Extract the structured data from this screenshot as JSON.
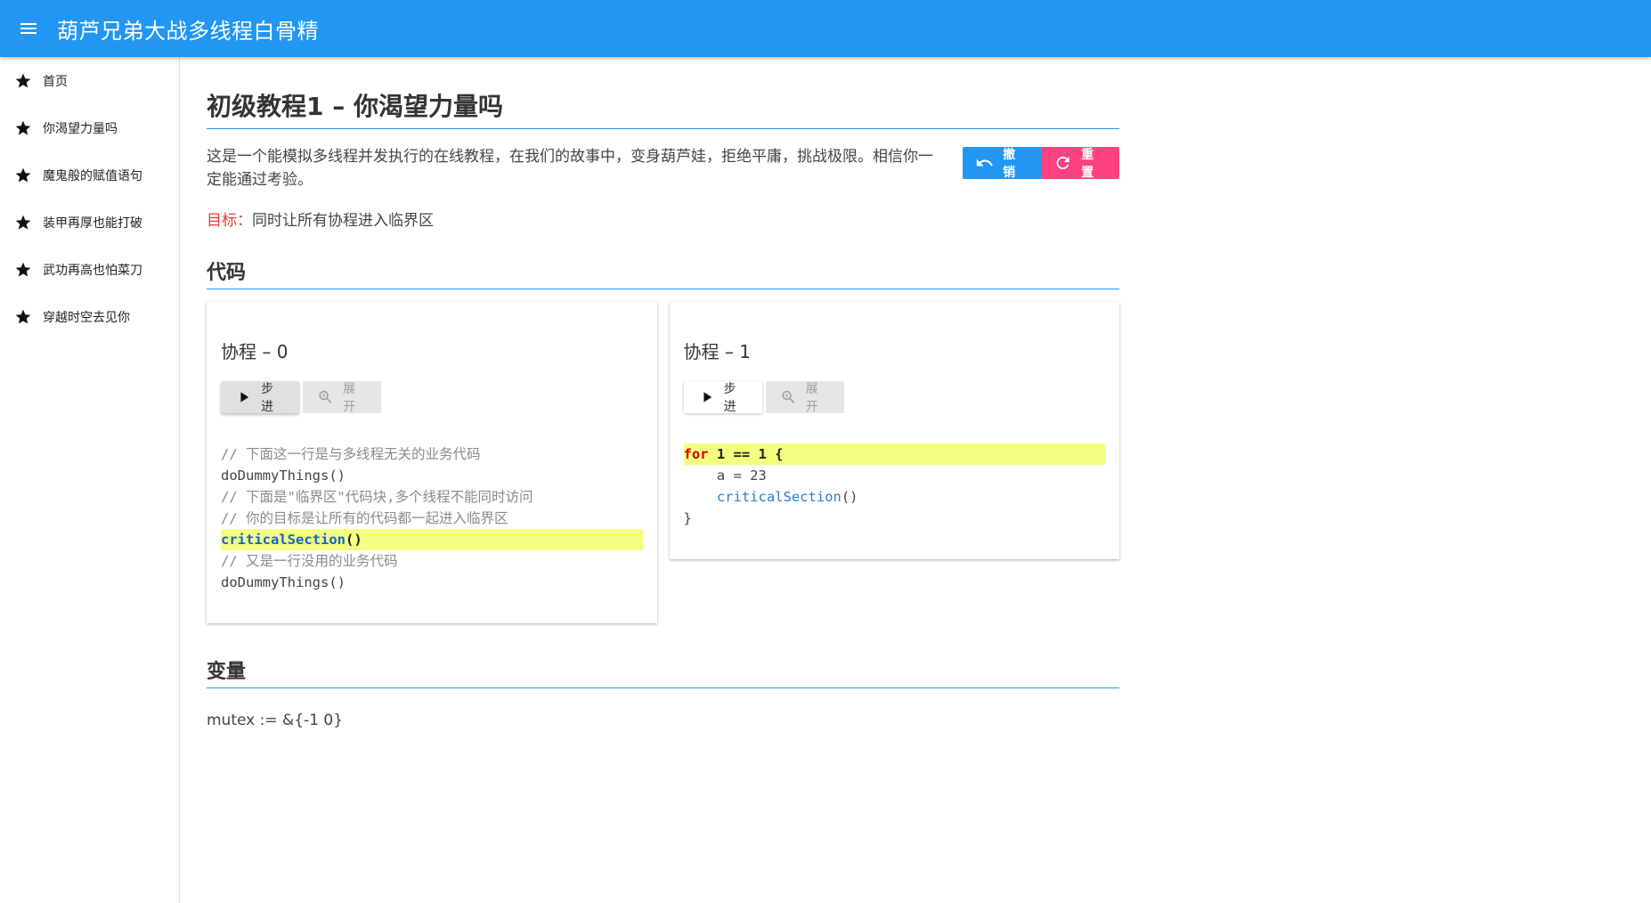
{
  "app": {
    "title": "葫芦兄弟大战多线程白骨精"
  },
  "sidebar": {
    "items": [
      {
        "label": "首页"
      },
      {
        "label": "你渴望力量吗"
      },
      {
        "label": "魔鬼般的赋值语句"
      },
      {
        "label": "装甲再厚也能打破"
      },
      {
        "label": "武功再高也怕菜刀"
      },
      {
        "label": "穿越时空去见你"
      }
    ]
  },
  "main": {
    "title": "初级教程1 – 你渴望力量吗",
    "intro": "这是一个能模拟多线程并发执行的在线教程，在我们的故事中，变身葫芦娃，拒绝平庸，挑战极限。相信你一定能通过考验。",
    "undo_label": "撤销",
    "reset_label": "重置",
    "goal_label": "目标：",
    "goal_text": "同时让所有协程进入临界区",
    "code_section": "代码",
    "vars_section": "变量",
    "step_label": "步进",
    "expand_label": "展开",
    "coroutines": [
      {
        "title": "协程 – 0",
        "lines": [
          "// 下面这一行是与多线程无关的业务代码",
          "doDummyThings",
          "()",
          "// 下面是\"临界区\"代码块,多个线程不能同时访问",
          "// 你的目标是让所有的代码都一起进入临界区",
          "criticalSection",
          "()",
          "// 又是一行没用的业务代码",
          "doDummyThings",
          "()"
        ]
      },
      {
        "title": "协程 – 1",
        "lines": [
          "for",
          " 1 == 1 {",
          "    a = 23",
          "    ",
          "criticalSection",
          "()",
          "}"
        ]
      }
    ],
    "variables": "mutex := &{-1 0}"
  },
  "colors": {
    "primary": "#2196f3",
    "accent": "#ff4081",
    "highlight": "#f4ff81"
  },
  "icons": {
    "menu": "menu-icon",
    "nav": "star-icon",
    "undo": "undo-icon",
    "reset": "refresh-icon",
    "step": "play-icon",
    "expand": "zoom-in-icon"
  }
}
